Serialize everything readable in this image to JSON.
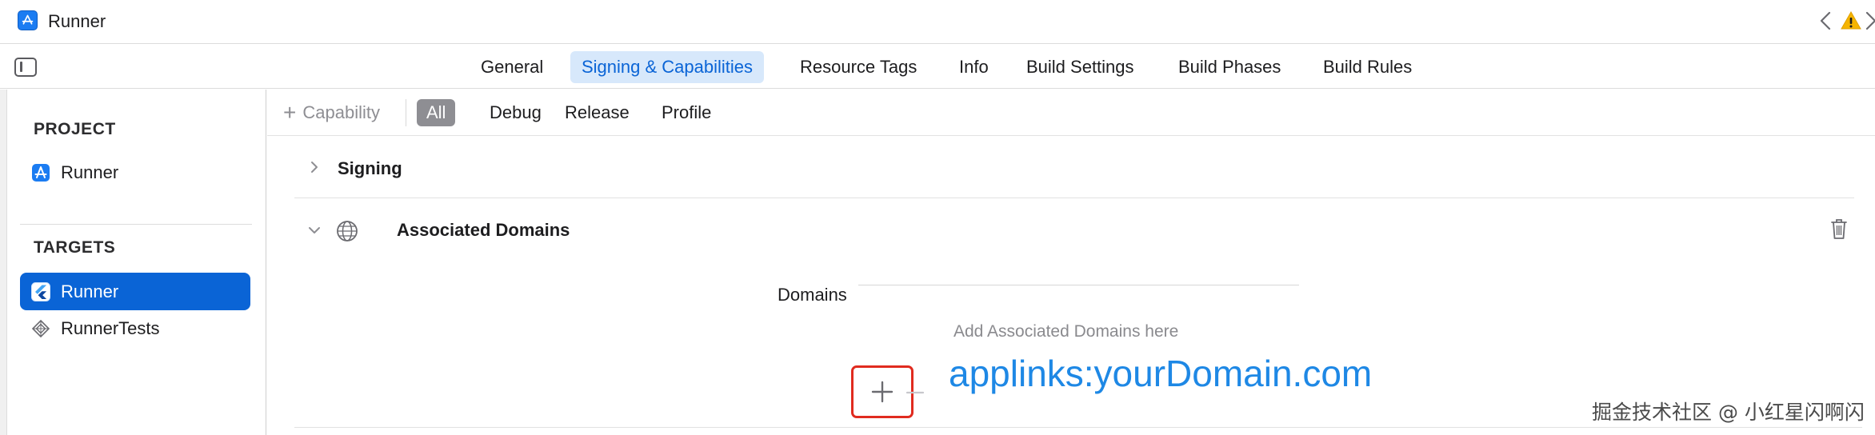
{
  "window": {
    "title": "Runner",
    "app_icon": "xcode-app-icon",
    "nav_back_icon": "chevron-left-icon",
    "warning_icon": "warning-triangle-icon",
    "warning_color": "#f5b400",
    "nav_forward_icon": "chevron-right-icon"
  },
  "tabs": [
    {
      "label": "General"
    },
    {
      "label": "Signing & Capabilities",
      "selected": true
    },
    {
      "label": "Resource Tags"
    },
    {
      "label": "Info"
    },
    {
      "label": "Build Settings"
    },
    {
      "label": "Build Phases"
    },
    {
      "label": "Build Rules"
    }
  ],
  "sidebar": {
    "project_header": "PROJECT",
    "project_item": "Runner",
    "targets_header": "TARGETS",
    "targets": [
      {
        "label": "Runner",
        "selected": true,
        "icon": "flutter-icon"
      },
      {
        "label": "RunnerTests",
        "selected": false,
        "icon": "test-bundle-icon"
      }
    ]
  },
  "filterbar": {
    "capability_label": "Capability",
    "filters": [
      {
        "label": "All",
        "selected": true
      },
      {
        "label": "Debug"
      },
      {
        "label": "Release"
      },
      {
        "label": "Profile"
      }
    ]
  },
  "capabilities": {
    "signing_title": "Signing",
    "associated_domains_title": "Associated Domains",
    "domains_label": "Domains",
    "domains_placeholder": "Add Associated Domains here",
    "add_button_icon": "plus-icon",
    "remove_button_icon": "minus-icon"
  },
  "annotation": {
    "text": "applinks:yourDomain.com",
    "color": "#1e88e5",
    "highlight_color": "#e02b1f"
  },
  "watermark": "掘金技术社区 @ 小红星闪啊闪",
  "colors": {
    "accent": "#0a64d6",
    "tab_selected_bg": "#d7e8fb"
  }
}
